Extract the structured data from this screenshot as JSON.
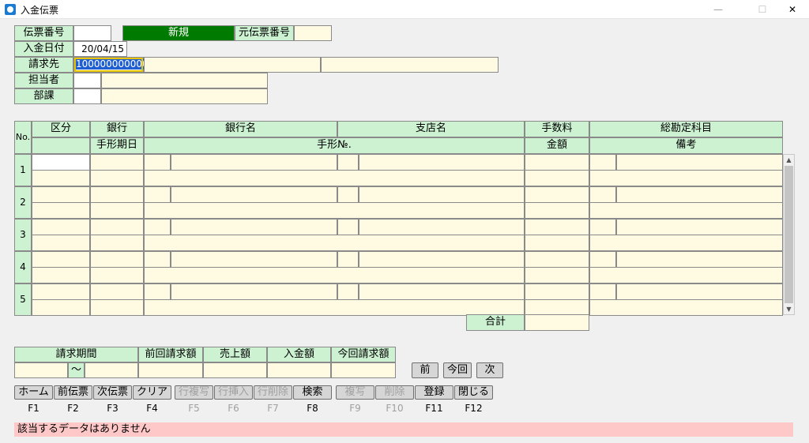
{
  "window": {
    "title": "入金伝票",
    "minimize": "—",
    "maximize": "☐",
    "close": "✕"
  },
  "header": {
    "denpyo_label": "伝票番号",
    "denpyo_value": "",
    "mode_label": "新規",
    "moto_label": "元伝票番号",
    "moto_value": "",
    "date_label": "入金日付",
    "date_value": "20/04/15",
    "seikyu_label": "請求先",
    "seikyu_code": "100000000000",
    "seikyu_name1": "",
    "seikyu_name2": "",
    "tanto_label": "担当者",
    "tanto_code": "",
    "tanto_name": "",
    "buka_label": "部課",
    "buka_code": "",
    "buka_name": ""
  },
  "grid": {
    "headers": {
      "no": "No.",
      "kubun": "区分",
      "ginko": "銀行",
      "ginko_name": "銀行名",
      "shiten_name": "支店名",
      "tesuryo": "手数料",
      "kamoku": "総勘定科目",
      "tegata_kijitsu": "手形期日",
      "tegata_no": "手形№.",
      "kingaku": "金額",
      "biko": "備考"
    },
    "rows": [
      {
        "no": "1"
      },
      {
        "no": "2"
      },
      {
        "no": "3"
      },
      {
        "no": "4"
      },
      {
        "no": "5"
      }
    ],
    "total_label": "合計",
    "total_value": ""
  },
  "summary": {
    "kikan_label": "請求期間",
    "tilde": "～",
    "zenkai_label": "前回請求額",
    "uriage_label": "売上額",
    "nyukin_label": "入金額",
    "konkai_label": "今回請求額"
  },
  "nav": {
    "prev": "前",
    "now": "今回",
    "next": "次"
  },
  "fkeys": [
    {
      "label": "ホーム",
      "key": "F1",
      "enabled": true
    },
    {
      "label": "前伝票",
      "key": "F2",
      "enabled": true
    },
    {
      "label": "次伝票",
      "key": "F3",
      "enabled": true
    },
    {
      "label": "クリア",
      "key": "F4",
      "enabled": true
    },
    {
      "label": "行複写",
      "key": "F5",
      "enabled": false
    },
    {
      "label": "行挿入",
      "key": "F6",
      "enabled": false
    },
    {
      "label": "行削除",
      "key": "F7",
      "enabled": false
    },
    {
      "label": "検索",
      "key": "F8",
      "enabled": true
    },
    {
      "label": "複写",
      "key": "F9",
      "enabled": false
    },
    {
      "label": "削除",
      "key": "F10",
      "enabled": false
    },
    {
      "label": "登録",
      "key": "F11",
      "enabled": true
    },
    {
      "label": "閉じる",
      "key": "F12",
      "enabled": true
    }
  ],
  "status": {
    "message": "該当するデータはありません"
  },
  "colors": {
    "label_bg": "#ccf2d2",
    "input_bg": "#fffbe3",
    "mode_bg": "#007a00",
    "status_bg": "#ffc8c8"
  }
}
